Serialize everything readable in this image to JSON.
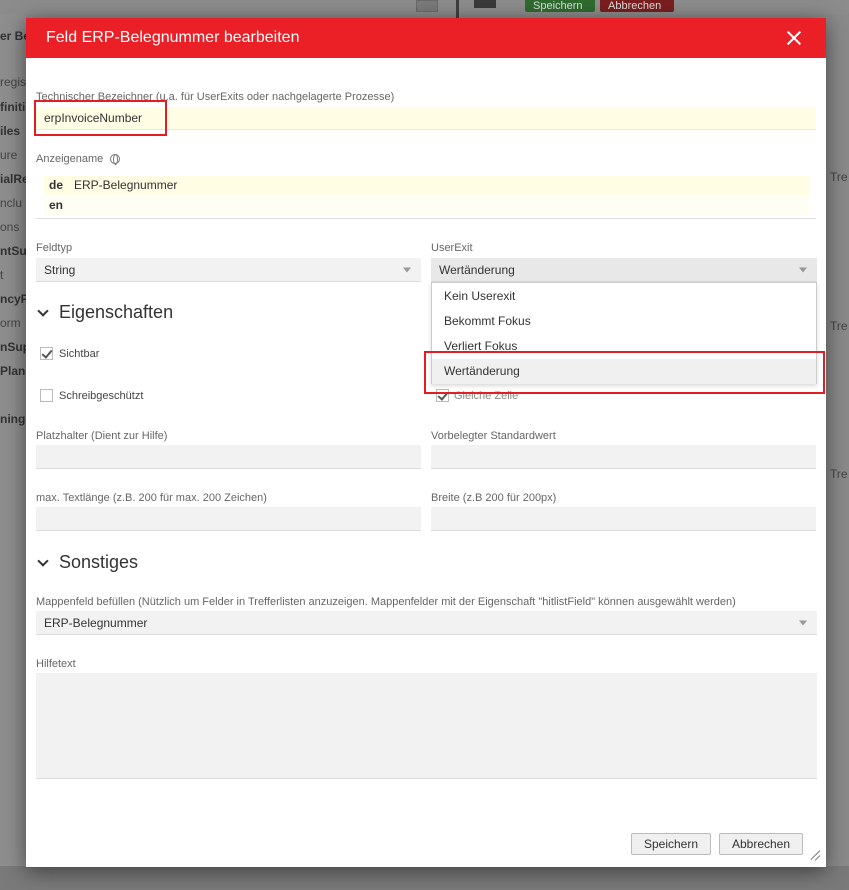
{
  "background": {
    "top_buttons": {
      "save": "Speichern",
      "cancel": "Abbrechen"
    },
    "left_items": [
      "er Be",
      "regis",
      "finiti",
      "iles",
      "ure",
      "ialRe",
      "nclu",
      "ons",
      "ntSu",
      "t",
      "ncyP",
      "orm",
      "nSup",
      "Plan",
      "ning"
    ],
    "right_items": [
      "Tre",
      "Tre",
      "Tre"
    ]
  },
  "dialog": {
    "title": "Feld ERP-Belegnummer bearbeiten",
    "tech_name": {
      "label": "Technischer Bezeichner (u.a. für UserExits oder nachgelagerte Prozesse)",
      "value": "erpInvoiceNumber"
    },
    "display_name": {
      "label": "Anzeigename",
      "rows": [
        {
          "code": "de",
          "value": "ERP-Belegnummer"
        },
        {
          "code": "en",
          "value": ""
        }
      ]
    },
    "field_type": {
      "label": "Feldtyp",
      "value": "String"
    },
    "user_exit": {
      "label": "UserExit",
      "value": "Wertänderung",
      "options": [
        "Kein Userexit",
        "Bekommt Fokus",
        "Verliert Fokus",
        "Wertänderung"
      ]
    },
    "section_properties": "Eigenschaften",
    "checkboxes": {
      "visible": {
        "label": "Sichtbar",
        "checked": true
      },
      "readonly": {
        "label": "Schreibgeschützt",
        "checked": false
      },
      "same_row": {
        "label": "Gleiche Zeile",
        "checked": true
      }
    },
    "placeholder": {
      "label": "Platzhalter (Dient zur Hilfe)",
      "value": ""
    },
    "default_value": {
      "label": "Vorbelegter Standardwert",
      "value": ""
    },
    "max_length": {
      "label": "max. Textlänge (z.B. 200 für max. 200 Zeichen)",
      "value": ""
    },
    "width": {
      "label": "Breite (z.B 200 für 200px)",
      "value": ""
    },
    "section_other": "Sonstiges",
    "folder_field": {
      "label": "Mappenfeld befüllen (Nützlich um Felder in Trefferlisten anzuzeigen. Mappenfelder mit der Eigenschaft \"hitlistField\" können ausgewählt werden)",
      "value": "ERP-Belegnummer"
    },
    "help_text": {
      "label": "Hilfetext",
      "value": ""
    },
    "buttons": {
      "save": "Speichern",
      "cancel": "Abbrechen"
    }
  }
}
